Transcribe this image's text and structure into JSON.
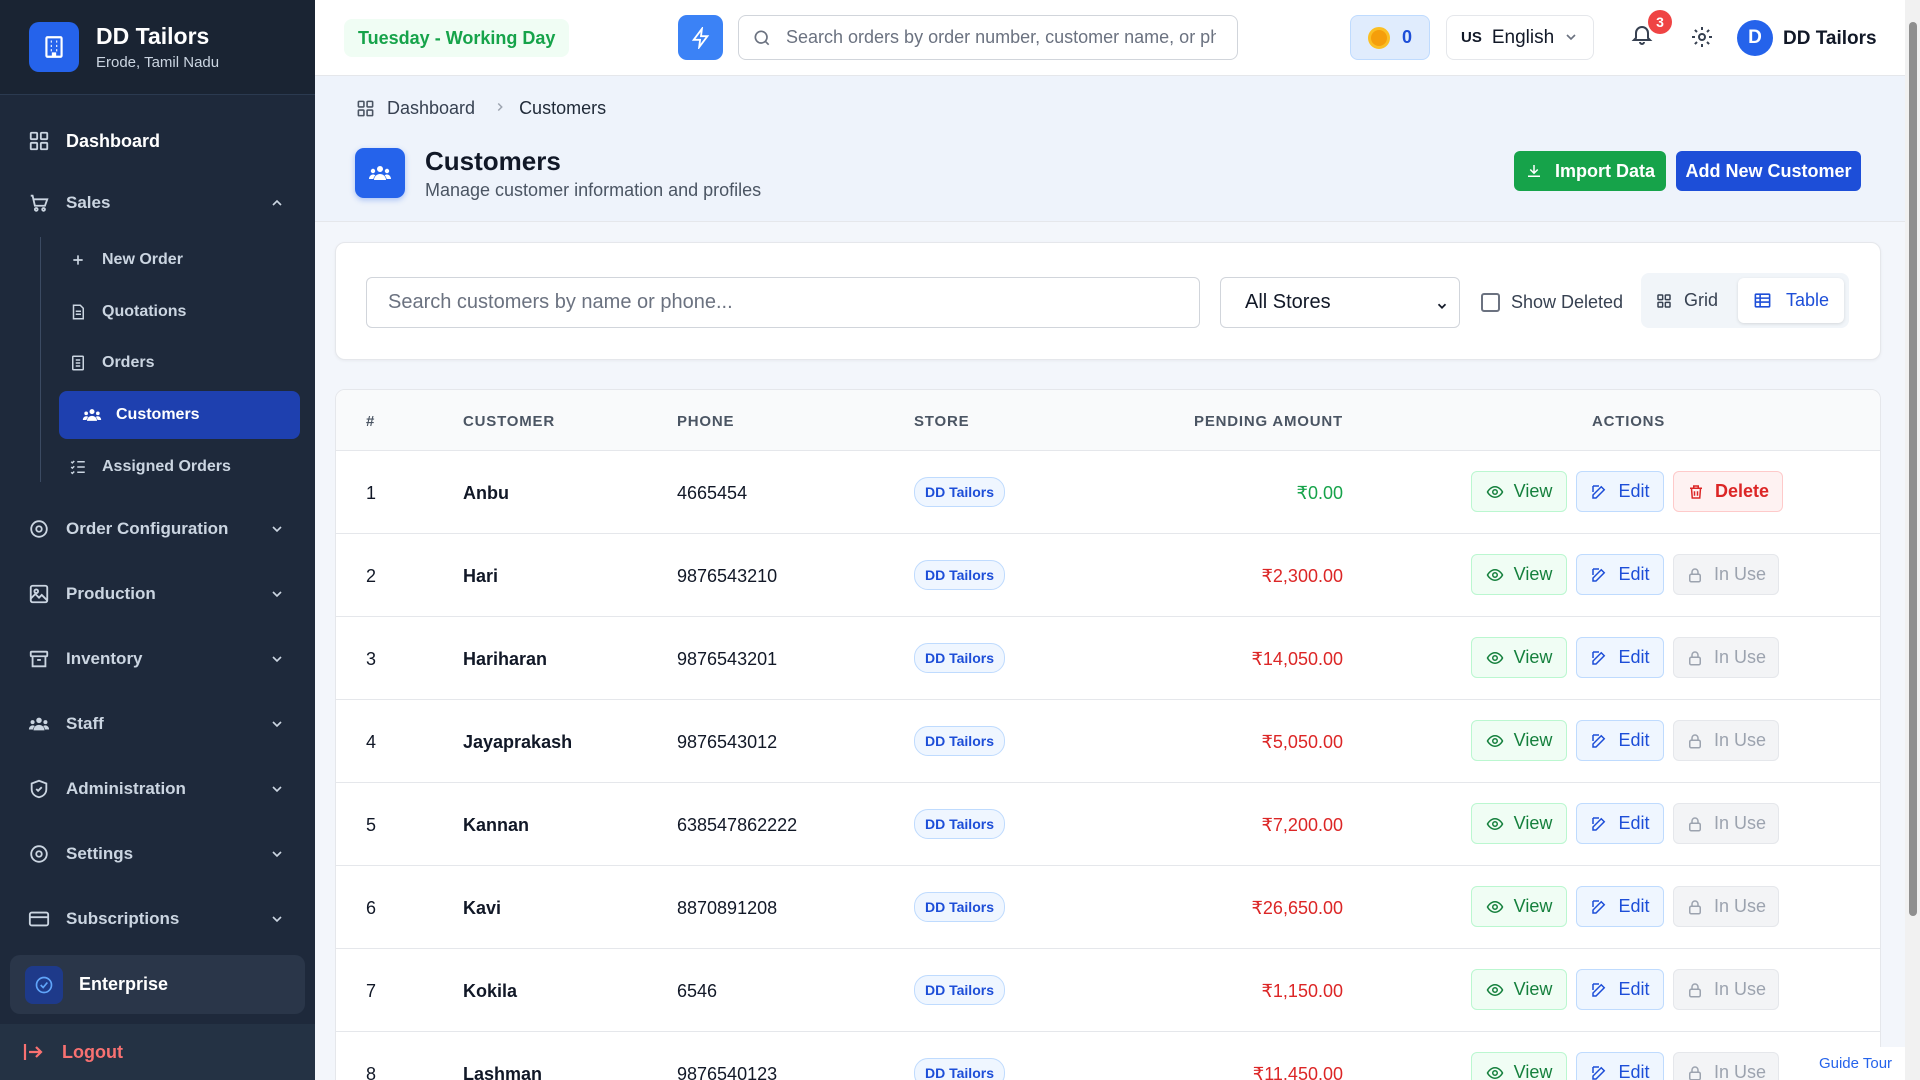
{
  "brand": {
    "name": "DD Tailors",
    "location": "Erode, Tamil Nadu"
  },
  "sidebar": {
    "dashboard": "Dashboard",
    "sales": "Sales",
    "sales_items": [
      {
        "label": "New Order",
        "icon": "plus-icon"
      },
      {
        "label": "Quotations",
        "icon": "document-icon"
      },
      {
        "label": "Orders",
        "icon": "list-document-icon"
      },
      {
        "label": "Customers",
        "icon": "users-icon",
        "active": true
      },
      {
        "label": "Assigned Orders",
        "icon": "checklist-icon"
      }
    ],
    "sections": [
      {
        "label": "Order Configuration",
        "icon": "gear-icon"
      },
      {
        "label": "Production",
        "icon": "image-icon"
      },
      {
        "label": "Inventory",
        "icon": "box-icon"
      },
      {
        "label": "Staff",
        "icon": "users-icon"
      },
      {
        "label": "Administration",
        "icon": "shield-icon"
      },
      {
        "label": "Settings",
        "icon": "gear-icon"
      },
      {
        "label": "Subscriptions",
        "icon": "card-icon"
      }
    ],
    "plan": "Enterprise",
    "logout": "Logout"
  },
  "header": {
    "day_status": "Tuesday - Working Day",
    "search_placeholder": "Search orders by order number, customer name, or phone",
    "coins": "0",
    "language_flag": "US",
    "language": "English",
    "notification_count": "3",
    "user_initial": "D",
    "user_name": "DD Tailors"
  },
  "breadcrumb": {
    "home": "Dashboard",
    "current": "Customers"
  },
  "page": {
    "title": "Customers",
    "subtitle": "Manage customer information and profiles",
    "import_label": "Import Data",
    "add_label": "Add New Customer"
  },
  "filters": {
    "search_placeholder": "Search customers by name or phone...",
    "store_selected": "All Stores",
    "show_deleted_label": "Show Deleted",
    "show_deleted_checked": false,
    "grid_label": "Grid",
    "table_label": "Table",
    "active_view": "Table"
  },
  "table": {
    "headers": {
      "num": "#",
      "customer": "CUSTOMER",
      "phone": "PHONE",
      "store": "STORE",
      "pending": "PENDING AMOUNT",
      "actions": "ACTIONS"
    },
    "view_label": "View",
    "edit_label": "Edit",
    "delete_label": "Delete",
    "inuse_label": "In Use",
    "rows": [
      {
        "num": "1",
        "customer": "Anbu",
        "phone": "4665454",
        "store": "DD Tailors",
        "pending": "₹0.00",
        "status": "delete"
      },
      {
        "num": "2",
        "customer": "Hari",
        "phone": "9876543210",
        "store": "DD Tailors",
        "pending": "₹2,300.00",
        "status": "in_use"
      },
      {
        "num": "3",
        "customer": "Hariharan",
        "phone": "9876543201",
        "store": "DD Tailors",
        "pending": "₹14,050.00",
        "status": "in_use"
      },
      {
        "num": "4",
        "customer": "Jayaprakash",
        "phone": "9876543012",
        "store": "DD Tailors",
        "pending": "₹5,050.00",
        "status": "in_use"
      },
      {
        "num": "5",
        "customer": "Kannan",
        "phone": "638547862222",
        "store": "DD Tailors",
        "pending": "₹7,200.00",
        "status": "in_use"
      },
      {
        "num": "6",
        "customer": "Kavi",
        "phone": "8870891208",
        "store": "DD Tailors",
        "pending": "₹26,650.00",
        "status": "in_use"
      },
      {
        "num": "7",
        "customer": "Kokila",
        "phone": "6546",
        "store": "DD Tailors",
        "pending": "₹1,150.00",
        "status": "in_use"
      },
      {
        "num": "8",
        "customer": "Lashman",
        "phone": "9876540123",
        "store": "DD Tailors",
        "pending": "₹11,450.00",
        "status": "in_use"
      }
    ]
  },
  "guide_tour": "Guide Tour",
  "colors": {
    "primary": "#2563eb",
    "success": "#16a34a",
    "danger": "#dc2626",
    "sidebar": "#1e293b"
  }
}
